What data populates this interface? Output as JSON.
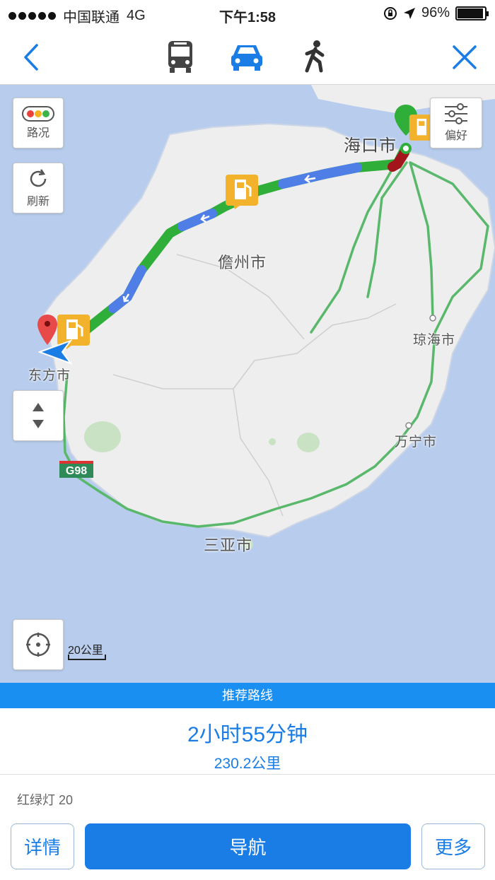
{
  "status_bar": {
    "carrier": "中国联通",
    "network": "4G",
    "time": "下午1:58",
    "battery": "96%"
  },
  "nav": {
    "back_icon": "chevron-left-icon",
    "modes": [
      {
        "name": "bus",
        "icon": "bus-icon",
        "active": false
      },
      {
        "name": "car",
        "icon": "car-icon",
        "active": true
      },
      {
        "name": "walk",
        "icon": "walking-person-icon",
        "active": false
      }
    ],
    "close_icon": "close-icon"
  },
  "map": {
    "traffic_button": "路况",
    "refresh_button": "刷新",
    "preference_button": "偏好",
    "cities": {
      "haikou": "海口市",
      "danzhou": "儋州市",
      "qionghai": "琼海市",
      "dongfang": "东方市",
      "wanning": "万宁市",
      "sanya": "三亚市"
    },
    "highway_shield": "G98",
    "scale_label": "20公里"
  },
  "route": {
    "recommend_label": "推荐路线",
    "duration": "2小时55分钟",
    "distance": "230.2公里",
    "traffic_lights": "红绿灯 20"
  },
  "actions": {
    "details": "详情",
    "navigate": "导航",
    "more": "更多"
  },
  "colors": {
    "accent": "#1a7de6",
    "route_green": "#2fae3a",
    "route_blue": "#4f7fe6",
    "water": "#b8cdee",
    "land": "#eeeeee"
  }
}
